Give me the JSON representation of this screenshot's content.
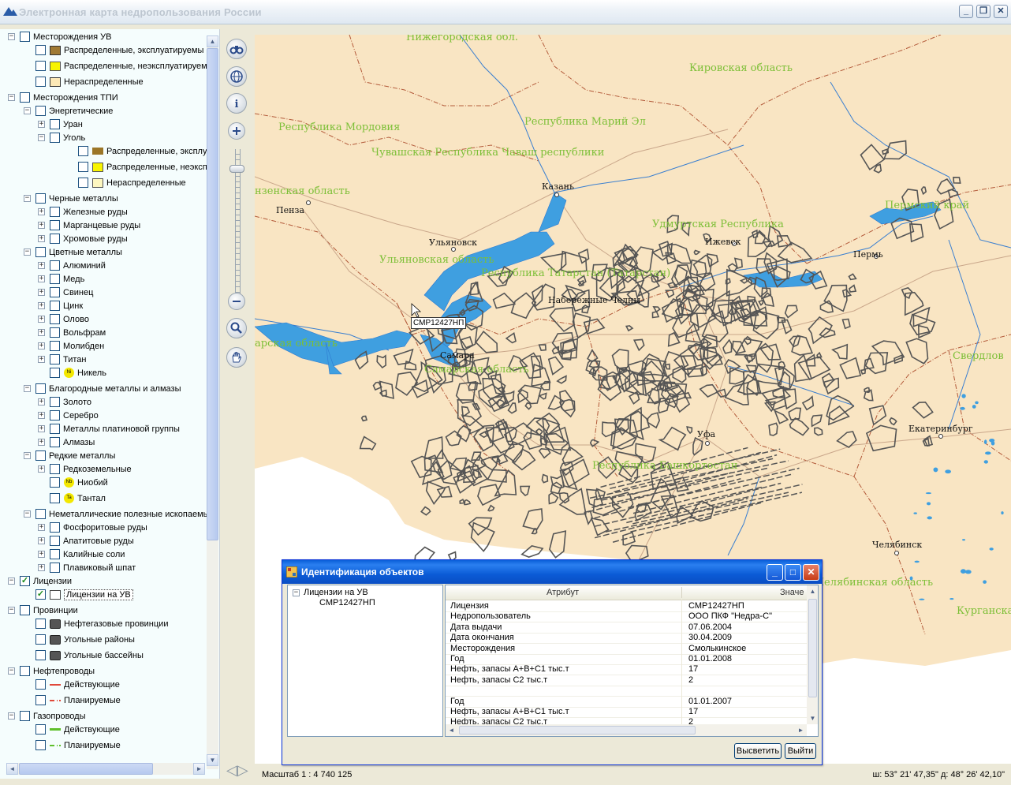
{
  "window": {
    "title": "Электронная карта недропользования России"
  },
  "layers": [
    {
      "level": 0,
      "exp": "−",
      "checked": false,
      "label": "Месторождения УВ"
    },
    {
      "level": 1,
      "exp": "",
      "checked": false,
      "sym": "brown",
      "label": "Распределенные, эксплуатируемы"
    },
    {
      "level": 1,
      "exp": "",
      "checked": false,
      "sym": "yellow",
      "label": "Распределенные, неэксплуатируем"
    },
    {
      "level": 1,
      "exp": "",
      "checked": false,
      "sym": "outline",
      "label": "Нераспределенные"
    },
    {
      "level": 0,
      "exp": "−",
      "checked": false,
      "label": "Месторождения ТПИ"
    },
    {
      "level": 1,
      "exp": "−",
      "checked": false,
      "label": "Энергетические"
    },
    {
      "level": 2,
      "exp": "+",
      "checked": false,
      "label": "Уран"
    },
    {
      "level": 2,
      "exp": "−",
      "checked": false,
      "label": "Уголь"
    },
    {
      "level": 3,
      "exp": "",
      "checked": false,
      "sym": "darkbrown",
      "label": "Распределенные, эксплуат"
    },
    {
      "level": 3,
      "exp": "",
      "checked": false,
      "sym": "yellow",
      "label": "Распределенные, неэксплу"
    },
    {
      "level": 3,
      "exp": "",
      "checked": false,
      "sym": "lightyellow",
      "label": "Нераспределенные"
    },
    {
      "level": 1,
      "exp": "−",
      "checked": false,
      "label": "Черные металлы"
    },
    {
      "level": 2,
      "exp": "+",
      "checked": false,
      "label": "Железные руды"
    },
    {
      "level": 2,
      "exp": "+",
      "checked": false,
      "label": "Марганцевые руды"
    },
    {
      "level": 2,
      "exp": "+",
      "checked": false,
      "label": "Хромовые руды"
    },
    {
      "level": 1,
      "exp": "−",
      "checked": false,
      "label": "Цветные металлы"
    },
    {
      "level": 2,
      "exp": "+",
      "checked": false,
      "label": "Алюминий"
    },
    {
      "level": 2,
      "exp": "+",
      "checked": false,
      "label": "Медь"
    },
    {
      "level": 2,
      "exp": "+",
      "checked": false,
      "label": "Свинец"
    },
    {
      "level": 2,
      "exp": "+",
      "checked": false,
      "label": "Цинк"
    },
    {
      "level": 2,
      "exp": "+",
      "checked": false,
      "label": "Олово"
    },
    {
      "level": 2,
      "exp": "+",
      "checked": false,
      "label": "Вольфрам"
    },
    {
      "level": 2,
      "exp": "+",
      "checked": false,
      "label": "Молибден"
    },
    {
      "level": 2,
      "exp": "+",
      "checked": false,
      "label": "Титан"
    },
    {
      "level": 2,
      "exp": "",
      "checked": false,
      "sym": "ni",
      "label": "Никель"
    },
    {
      "level": 1,
      "exp": "−",
      "checked": false,
      "label": "Благородные металлы и алмазы"
    },
    {
      "level": 2,
      "exp": "+",
      "checked": false,
      "label": "Золото"
    },
    {
      "level": 2,
      "exp": "+",
      "checked": false,
      "label": "Серебро"
    },
    {
      "level": 2,
      "exp": "+",
      "checked": false,
      "label": "Металлы платиновой группы"
    },
    {
      "level": 2,
      "exp": "+",
      "checked": false,
      "label": "Алмазы"
    },
    {
      "level": 1,
      "exp": "−",
      "checked": false,
      "label": "Редкие металлы"
    },
    {
      "level": 2,
      "exp": "+",
      "checked": false,
      "label": "Редкоземельные"
    },
    {
      "level": 2,
      "exp": "",
      "checked": false,
      "sym": "nb",
      "label": "Ниобий"
    },
    {
      "level": 2,
      "exp": "",
      "checked": false,
      "sym": "ta",
      "label": "Тантал"
    },
    {
      "level": 1,
      "exp": "−",
      "checked": false,
      "label": "Неметаллические полезные ископаемы"
    },
    {
      "level": 2,
      "exp": "+",
      "checked": false,
      "label": "Фосфоритовые руды"
    },
    {
      "level": 2,
      "exp": "+",
      "checked": false,
      "label": "Апатитовые руды"
    },
    {
      "level": 2,
      "exp": "+",
      "checked": false,
      "label": "Калийные соли"
    },
    {
      "level": 2,
      "exp": "+",
      "checked": false,
      "label": "Плавиковый шпат"
    },
    {
      "level": 0,
      "exp": "−",
      "checked": true,
      "label": "Лицензии"
    },
    {
      "level": 1,
      "exp": "",
      "checked": true,
      "sym": "outline-white",
      "label": "Лицензии на УВ",
      "selected": true
    },
    {
      "level": 0,
      "exp": "−",
      "checked": false,
      "label": "Провинции"
    },
    {
      "level": 1,
      "exp": "",
      "checked": false,
      "sym": "gray",
      "label": "Нефтегазовые провинции"
    },
    {
      "level": 1,
      "exp": "",
      "checked": false,
      "sym": "gray",
      "label": "Угольные районы"
    },
    {
      "level": 1,
      "exp": "",
      "checked": false,
      "sym": "gray",
      "label": "Угольные бассейны"
    },
    {
      "level": 0,
      "exp": "−",
      "checked": false,
      "label": "Нефтепроводы"
    },
    {
      "level": 1,
      "exp": "",
      "checked": false,
      "sym": "redline",
      "label": "Действующие"
    },
    {
      "level": 1,
      "exp": "",
      "checked": false,
      "sym": "reddash",
      "label": "Планируемые"
    },
    {
      "level": 0,
      "exp": "−",
      "checked": false,
      "label": "Газопроводы"
    },
    {
      "level": 1,
      "exp": "",
      "checked": false,
      "sym": "greenline",
      "label": "Действующие"
    },
    {
      "level": 1,
      "exp": "",
      "checked": false,
      "sym": "greendash",
      "label": "Планируемые"
    }
  ],
  "map": {
    "regions": [
      "Нижегородская обл.",
      "Кировская область",
      "Республика Мордовия",
      "Республика Марий Эл",
      "Чувашская Республика Чаваш республики",
      "нзенская область",
      "Удмуртская Республика",
      "Пермский край",
      "Ульяновская область",
      "Республика Татарстан (Татарстан)",
      "Самарская область",
      "арская область",
      "Республика Башкортостан",
      "Свердлов",
      "Челябинская область",
      "Курганска"
    ],
    "cities": [
      "Пенза",
      "Казань",
      "Ульяновск",
      "Ижевск",
      "Пермь",
      "Набережные Челны",
      "Самара",
      "Уфа",
      "Екатеринбург",
      "Челябинск"
    ],
    "tooltip": "СМР12427НП"
  },
  "status": {
    "scale": "Масштаб 1 : 4 740 125",
    "coords": "ш: 53° 21' 47,35\" д: 48° 26' 42,10\""
  },
  "dialog": {
    "title": "Идентификация объектов",
    "tree": {
      "root": "Лицензии на УВ",
      "child": "СМР12427НП"
    },
    "columns": [
      "Атрибут",
      "Значе"
    ],
    "rows": [
      {
        "attr": "Лицензия",
        "value": "СМР12427НП"
      },
      {
        "attr": "Недропользователь",
        "value": "ООО ПКФ \"Недра-С\""
      },
      {
        "attr": "Дата выдачи",
        "value": "07.06.2004"
      },
      {
        "attr": "Дата окончания",
        "value": "30.04.2009"
      },
      {
        "attr": "Месторождения",
        "value": "Смолькинское"
      },
      {
        "attr": "Год",
        "value": "01.01.2008"
      },
      {
        "attr": "Нефть, запасы А+В+С1 тыс.т",
        "value": "17"
      },
      {
        "attr": "Нефть, запасы С2 тыс.т",
        "value": "2"
      },
      {
        "attr": "",
        "value": ""
      },
      {
        "attr": "Год",
        "value": "01.01.2007"
      },
      {
        "attr": "Нефть, запасы А+В+С1 тыс.т",
        "value": "17"
      },
      {
        "attr": "Нефть, запасы С2 тыс.т",
        "value": "2"
      }
    ],
    "buttons": {
      "highlight": "Высветить",
      "exit": "Выйти"
    }
  },
  "colors": {
    "land": "#f9e5c3",
    "water": "#3f9fe0",
    "licenses": "#555555",
    "region_label": "#7cbf36",
    "title_bar": "#0a5fd8"
  }
}
